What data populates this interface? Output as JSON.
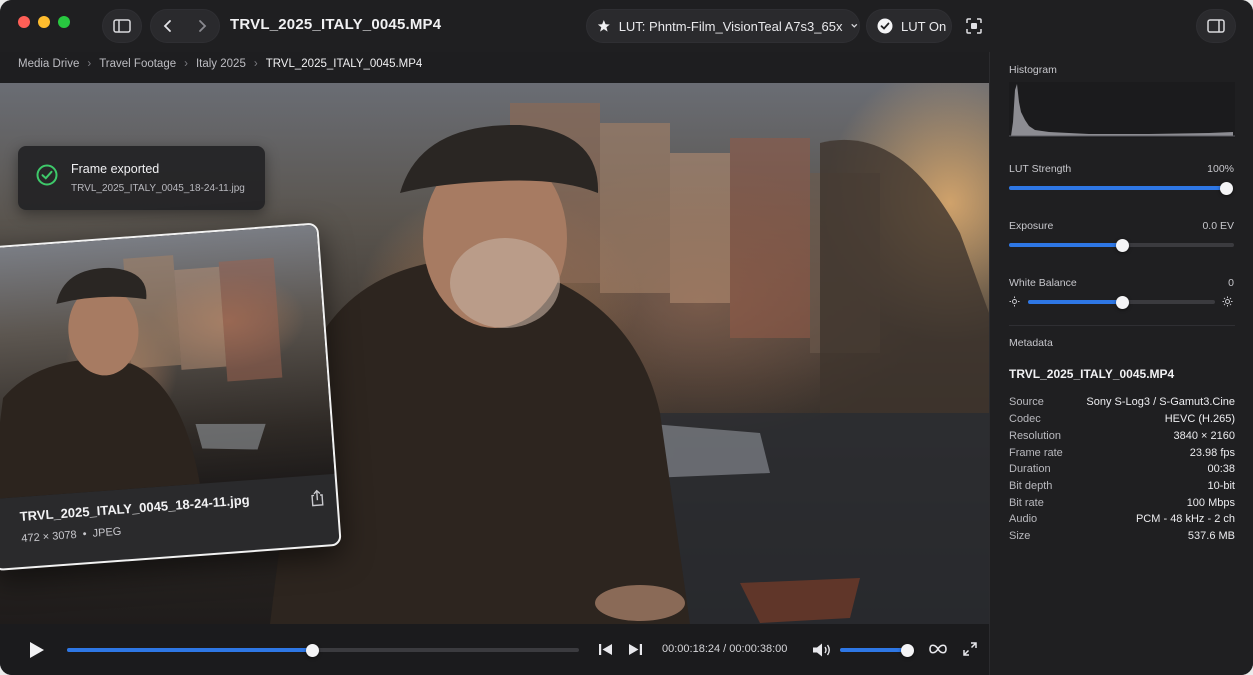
{
  "window": {
    "title": "TRVL_2025_ITALY_0045.MP4",
    "lut_label": "LUT: Phntm-Film_VisionTeal A7s3_65x",
    "lut_toggle_label": "LUT On"
  },
  "breadcrumb": [
    "Media Drive",
    "Travel Footage",
    "Italy 2025",
    "TRVL_2025_ITALY_0045.MP4"
  ],
  "toast": {
    "title": "Frame exported",
    "filename": "TRVL_2025_ITALY_0045_18-24-11.jpg"
  },
  "thumbnail": {
    "name": "TRVL_2025_ITALY_0045_18-24-11.jpg",
    "dimensions": "472 × 3078",
    "format": "JPEG"
  },
  "player": {
    "progress": 0.4792,
    "timecode": "00:00:18:24 / 00:00:38:00",
    "volume": 0.9
  },
  "panel": {
    "histogram_label": "Histogram",
    "lut_strength": {
      "label": "LUT Strength",
      "value": "100%",
      "level": 1.0
    },
    "exposure": {
      "label": "Exposure",
      "value": "0.0 EV",
      "level": 0.5
    },
    "white_balance": {
      "label": "White Balance",
      "value": "0",
      "level": 0.5
    },
    "metadata_label": "Metadata",
    "metadata_title": "TRVL_2025_ITALY_0045.MP4",
    "metadata": [
      {
        "key": "Source",
        "value": "Sony S-Log3 / S-Gamut3.Cine"
      },
      {
        "key": "Codec",
        "value": "HEVC (H.265)"
      },
      {
        "key": "Resolution",
        "value": "3840 × 2160"
      },
      {
        "key": "Frame rate",
        "value": "23.98 fps"
      },
      {
        "key": "Duration",
        "value": "00:38"
      },
      {
        "key": "Bit depth",
        "value": "10-bit"
      },
      {
        "key": "Bit rate",
        "value": "100 Mbps"
      },
      {
        "key": "Audio",
        "value": "PCM - 48 kHz - 2 ch"
      },
      {
        "key": "Size",
        "value": "537.6 MB"
      }
    ]
  },
  "colors": {
    "accent": "#2e77e5",
    "success": "#3ec96a",
    "close": "#fe5f57",
    "minimize": "#febc2e",
    "zoom": "#28c840"
  }
}
